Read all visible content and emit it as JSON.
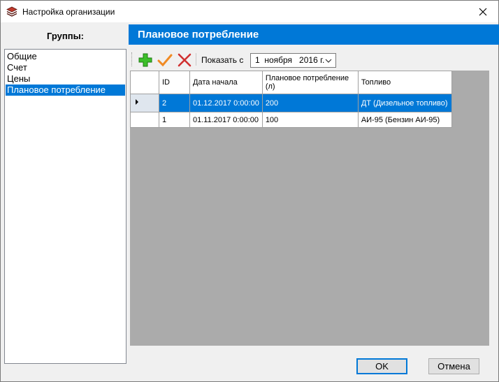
{
  "window": {
    "title": "Настройка организации"
  },
  "groups": {
    "header": "Группы:",
    "items": [
      {
        "label": "Общие"
      },
      {
        "label": "Счет"
      },
      {
        "label": "Цены"
      },
      {
        "label": "Плановое потребление"
      }
    ],
    "selected_index": 3
  },
  "section": {
    "title": "Плановое потребление",
    "toolbar": {
      "show_label": "Показать с",
      "date_value": "1  ноября   2016 г."
    },
    "grid": {
      "columns": [
        "ID",
        "Дата начала",
        "Плановое потребление (л)",
        "Топливо"
      ],
      "rows": [
        {
          "id": "2",
          "start": "01.12.2017 0:00:00",
          "plan": "200",
          "fuel": "ДТ (Дизельное топливо)",
          "selected": true
        },
        {
          "id": "1",
          "start": "01.11.2017 0:00:00",
          "plan": "100",
          "fuel": "АИ-95 (Бензин АИ-95)",
          "selected": false
        }
      ]
    }
  },
  "buttons": {
    "ok": "OK",
    "cancel": "Отмена"
  },
  "colors": {
    "accent": "#0078d7",
    "grid_bg": "#ababab"
  }
}
